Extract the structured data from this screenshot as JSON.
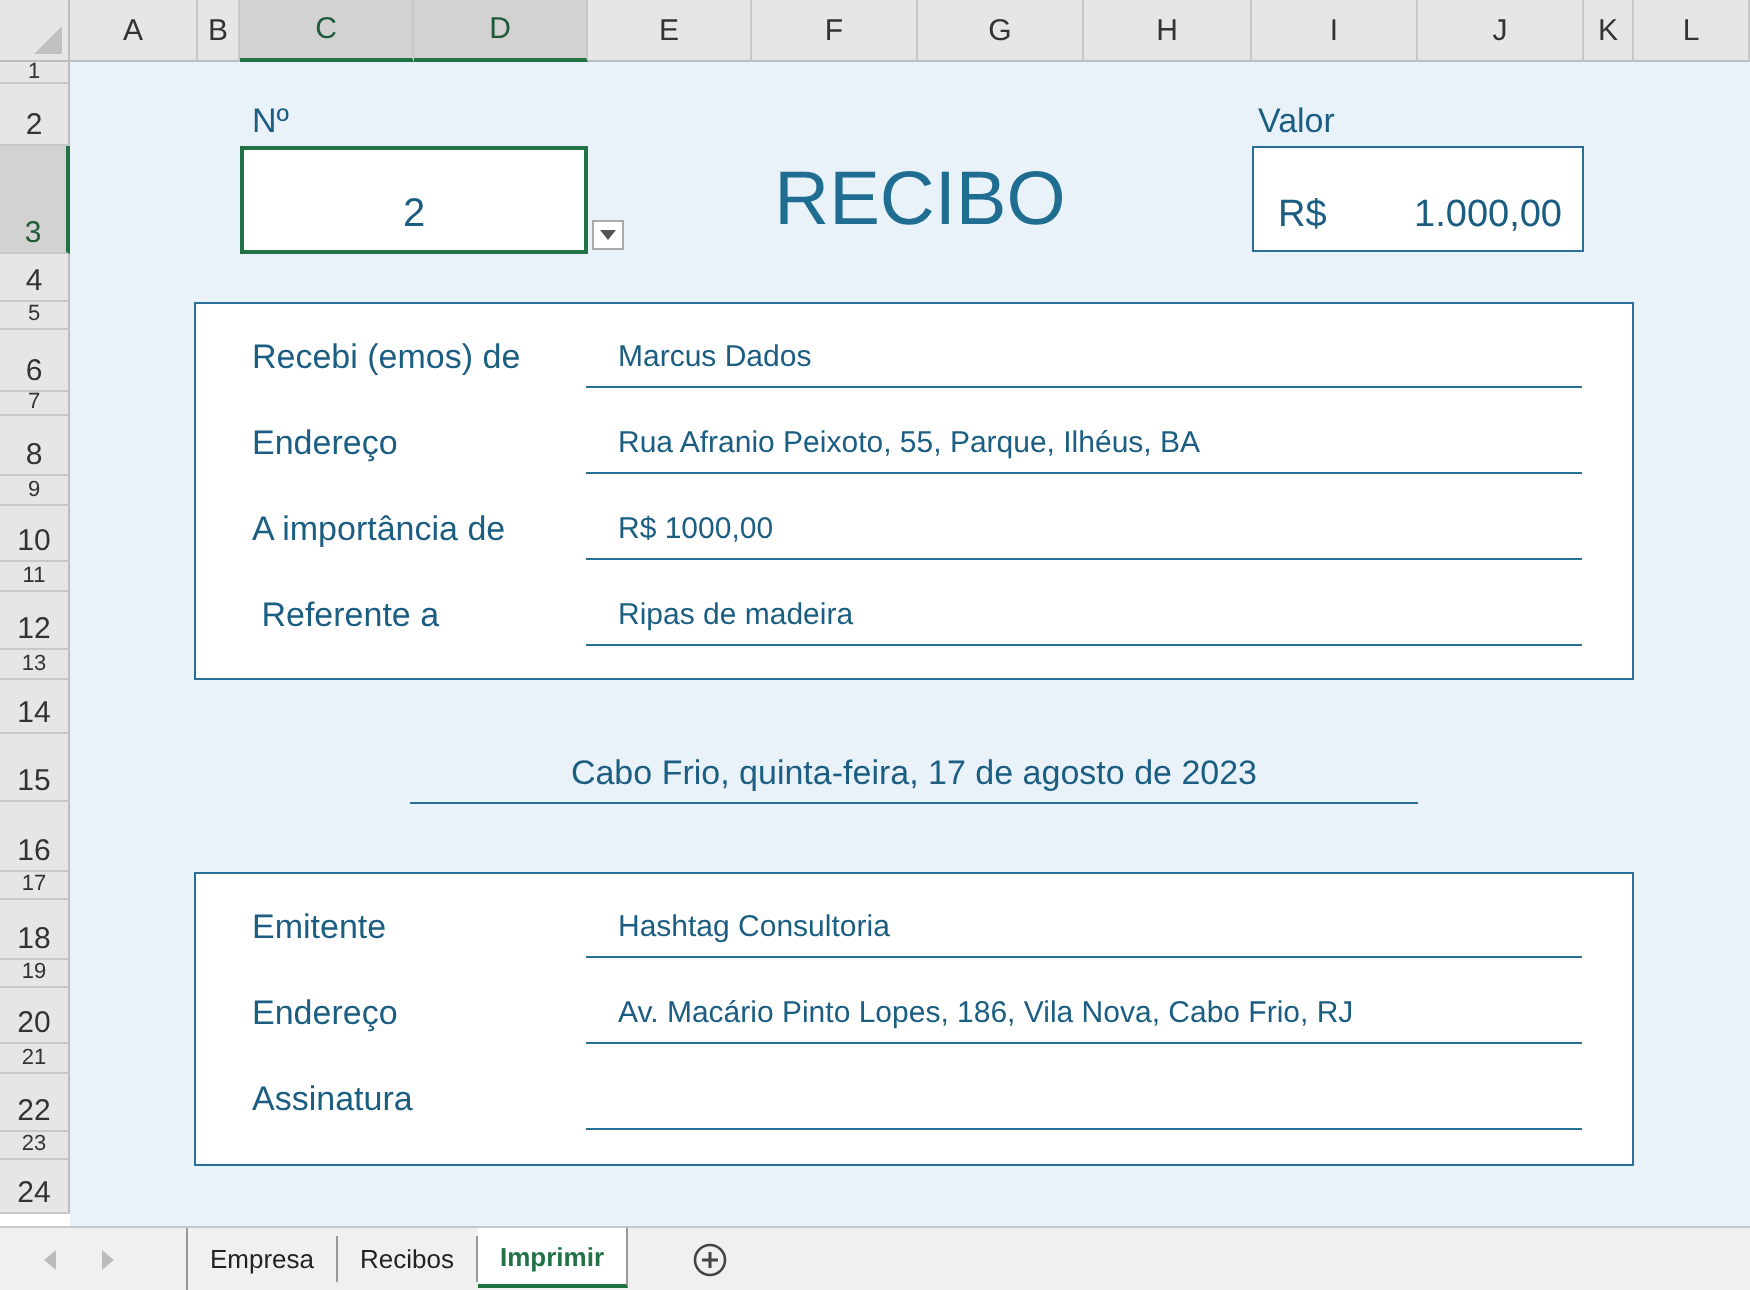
{
  "column_headers": [
    {
      "label": "A",
      "selected": false
    },
    {
      "label": "B",
      "selected": false
    },
    {
      "label": "C",
      "selected": true
    },
    {
      "label": "D",
      "selected": true
    },
    {
      "label": "E",
      "selected": false
    },
    {
      "label": "F",
      "selected": false
    },
    {
      "label": "G",
      "selected": false
    },
    {
      "label": "H",
      "selected": false
    },
    {
      "label": "I",
      "selected": false
    },
    {
      "label": "J",
      "selected": false
    },
    {
      "label": "K",
      "selected": false
    },
    {
      "label": "L",
      "selected": false
    }
  ],
  "row_headers": [
    {
      "label": "1",
      "selected": false
    },
    {
      "label": "2",
      "selected": false
    },
    {
      "label": "3",
      "selected": true
    },
    {
      "label": "4",
      "selected": false
    },
    {
      "label": "5",
      "selected": false
    },
    {
      "label": "6",
      "selected": false
    },
    {
      "label": "7",
      "selected": false
    },
    {
      "label": "8",
      "selected": false
    },
    {
      "label": "9",
      "selected": false
    },
    {
      "label": "10",
      "selected": false
    },
    {
      "label": "11",
      "selected": false
    },
    {
      "label": "12",
      "selected": false
    },
    {
      "label": "13",
      "selected": false
    },
    {
      "label": "14",
      "selected": false
    },
    {
      "label": "15",
      "selected": false
    },
    {
      "label": "16",
      "selected": false
    },
    {
      "label": "17",
      "selected": false
    },
    {
      "label": "18",
      "selected": false
    },
    {
      "label": "19",
      "selected": false
    },
    {
      "label": "20",
      "selected": false
    },
    {
      "label": "21",
      "selected": false
    },
    {
      "label": "22",
      "selected": false
    },
    {
      "label": "23",
      "selected": false
    },
    {
      "label": "24",
      "selected": false
    }
  ],
  "number_field": {
    "label": "Nº",
    "value": "2",
    "selected": true
  },
  "title": "RECIBO",
  "value_field": {
    "label": "Valor",
    "currency": "R$",
    "amount": "1.000,00"
  },
  "payer_section": [
    {
      "label": "Recebi (emos) de",
      "value": "Marcus Dados"
    },
    {
      "label": "Endereço",
      "value": "Rua Afranio Peixoto, 55, Parque, Ilhéus, BA"
    },
    {
      "label": "A importância de",
      "value": "R$ 1000,00"
    },
    {
      "label": " Referente a",
      "value": "Ripas de madeira"
    }
  ],
  "date_line": "Cabo Frio, quinta-feira, 17 de agosto de 2023",
  "issuer_section": [
    {
      "label": "Emitente",
      "value": "Hashtag Consultoria"
    },
    {
      "label": "Endereço",
      "value": "Av. Macário Pinto Lopes, 186, Vila Nova, Cabo Frio, RJ"
    },
    {
      "label": "Assinatura"
    }
  ],
  "sheet_tabs": [
    {
      "label": "Empresa",
      "selected": false
    },
    {
      "label": "Recibos",
      "selected": false
    },
    {
      "label": "Imprimir",
      "selected": true
    }
  ]
}
